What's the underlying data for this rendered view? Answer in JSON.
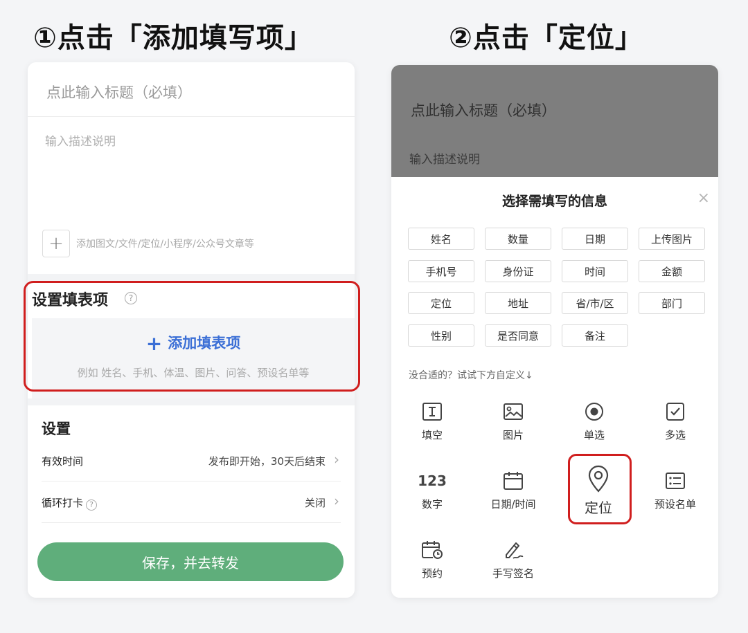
{
  "steps": {
    "step1": "①点击「添加填写项」",
    "step2": "②点击「定位」"
  },
  "left": {
    "title_placeholder": "点此输入标题（必填）",
    "desc_placeholder": "输入描述说明",
    "add_attachment_text": "添加图文/文件/定位/小程序/公众号文章等",
    "form_items_section": {
      "title": "设置填表项",
      "add_button_label": "添加填表项",
      "add_hint": "例如 姓名、手机、体温、图片、问答、预设名单等"
    },
    "settings": {
      "title": "设置",
      "rows": [
        {
          "label": "有效时间",
          "value": "发布即开始，30天后结束"
        },
        {
          "label": "循环打卡",
          "value": "关闭"
        }
      ],
      "save_button": "保存，并去转发"
    }
  },
  "right": {
    "title_placeholder": "点此输入标题（必填）",
    "desc_placeholder": "输入描述说明",
    "sheet_title": "选择需填写的信息",
    "close_icon": "close-icon",
    "chips": [
      "姓名",
      "数量",
      "日期",
      "上传图片",
      "手机号",
      "身份证",
      "时间",
      "金额",
      "定位",
      "地址",
      "省/市/区",
      "部门",
      "性别",
      "是否同意",
      "备注"
    ],
    "custom_hint": "没合适的？试试下方自定义↓",
    "tools": [
      {
        "label": "填空",
        "icon": "text-field-icon"
      },
      {
        "label": "图片",
        "icon": "image-icon"
      },
      {
        "label": "单选",
        "icon": "radio-icon"
      },
      {
        "label": "多选",
        "icon": "checkbox-icon"
      },
      {
        "label": "数字",
        "icon": "number-icon",
        "glyph": "123"
      },
      {
        "label": "日期/时间",
        "icon": "calendar-icon"
      },
      {
        "label": "定位",
        "icon": "location-pin-icon"
      },
      {
        "label": "预设名单",
        "icon": "list-icon"
      },
      {
        "label": "预约",
        "icon": "calendar-clock-icon"
      },
      {
        "label": "手写签名",
        "icon": "signature-pen-icon"
      }
    ]
  },
  "colors": {
    "accent_blue": "#3b6fd6",
    "save_green": "#5fae7b",
    "highlight_red": "#d01e1e"
  }
}
